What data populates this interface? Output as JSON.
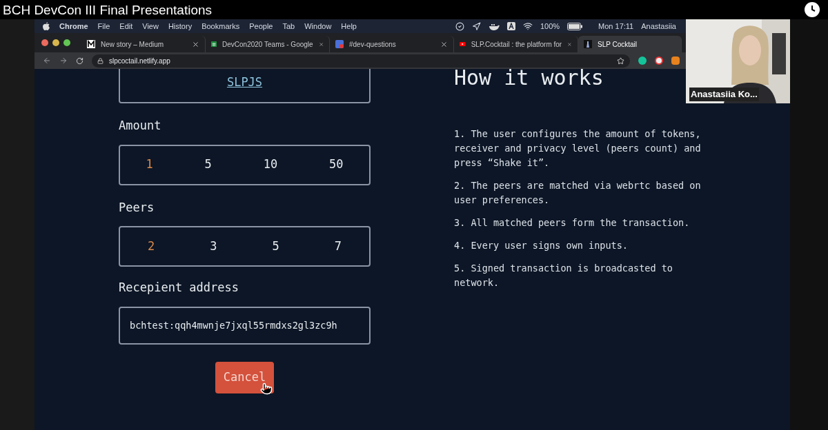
{
  "video": {
    "title": "BCH DevCon III Final Presentations"
  },
  "menu_bar": {
    "app": "Chrome",
    "items": [
      "File",
      "Edit",
      "View",
      "History",
      "Bookmarks",
      "People",
      "Tab",
      "Window",
      "Help"
    ],
    "battery": "100%",
    "clock": "Mon 17:11",
    "user": "Anastasiia"
  },
  "tabs": [
    {
      "title": "New story – Medium",
      "selected": false,
      "kind": "medium"
    },
    {
      "title": "DevCon2020 Teams - Google",
      "selected": false,
      "kind": "sheets"
    },
    {
      "title": "#dev-questions",
      "selected": false,
      "kind": "chat"
    },
    {
      "title": "SLP.Cocktail : the platform for",
      "selected": false,
      "kind": "video"
    },
    {
      "title": "SLP Cocktail",
      "selected": true,
      "kind": "site"
    }
  ],
  "address_bar": {
    "url": "slpcoctail.netlify.app"
  },
  "page": {
    "library_link": "SLPJS",
    "amount": {
      "label": "Amount",
      "options": [
        {
          "label": "1",
          "selected": true
        },
        {
          "label": "5",
          "selected": false
        },
        {
          "label": "10",
          "selected": false
        },
        {
          "label": "50",
          "selected": false
        }
      ]
    },
    "peers": {
      "label": "Peers",
      "options": [
        {
          "label": "2",
          "selected": true
        },
        {
          "label": "3",
          "selected": false
        },
        {
          "label": "5",
          "selected": false
        },
        {
          "label": "7",
          "selected": false
        }
      ]
    },
    "recipient": {
      "label": "Recepient address",
      "value": "bchtest:qqh4mwnje7jxql55rmdxs2gl3zc9h"
    },
    "cancel_button": "Cancel",
    "how_it_works": {
      "title": "How it works",
      "steps": [
        "1. The user configures the amount of tokens, receiver and privacy level (peers count) and press “Shake it”.",
        "2. The peers are matched via webrtc based on user preferences.",
        "3. All matched peers form the transaction.",
        "4. Every user signs own inputs.",
        "5. Signed transaction is broadcasted to network."
      ]
    }
  },
  "webcam": {
    "name": "Anastasiia Ko..."
  }
}
